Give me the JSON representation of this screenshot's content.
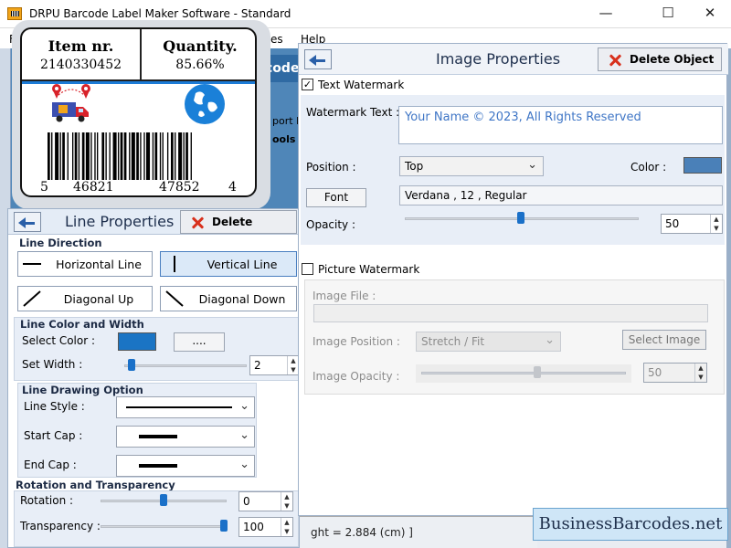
{
  "window": {
    "title": "DRPU Barcode Label Maker Software - Standard",
    "minimize_glyph": "—",
    "maximize_glyph": "☐",
    "close_glyph": "✕"
  },
  "background": {
    "menu_fragments": [
      "F",
      "es",
      "Help"
    ],
    "toolbar_fragment": "code",
    "export_fragment": "port I",
    "tools_fragment": "ools",
    "status_text": "ght = 2.884 (cm) ]"
  },
  "label": {
    "item_key": "Item nr.",
    "item_value": "2140330452",
    "qty_key": "Quantity.",
    "qty_value": "85.66%",
    "barcode_digits": [
      "5",
      "46821",
      "47852",
      "4"
    ]
  },
  "line_properties": {
    "title": "Line Properties",
    "delete_label": "Delete Object",
    "direction": {
      "title": "Line Direction",
      "options": [
        "Horizontal Line",
        "Vertical Line",
        "Diagonal Up",
        "Diagonal Down"
      ],
      "selected": "Vertical Line"
    },
    "color_width": {
      "title": "Line Color and Width",
      "select_color_label": "Select Color :",
      "color": "#1a74c4",
      "more_button": "....",
      "set_width_label": "Set Width :",
      "width_value": "2"
    },
    "drawing": {
      "title": "Line Drawing Option",
      "line_style_label": "Line Style :",
      "start_cap_label": "Start Cap :",
      "end_cap_label": "End Cap :"
    },
    "rotation": {
      "title": "Rotation and Transparency",
      "rotation_label": "Rotation :",
      "rotation_value": "0",
      "transparency_label": "Transparency :",
      "transparency_value": "100"
    }
  },
  "image_properties": {
    "title": "Image Properties",
    "delete_label": "Delete Object",
    "text_watermark": {
      "checkbox_label": "Text Watermark",
      "checked": true,
      "text_label": "Watermark Text :",
      "text_value": "Your Name © 2023, All Rights Reserved",
      "position_label": "Position :",
      "position_value": "Top",
      "color_label": "Color :",
      "color": "#4a80b8",
      "font_button": "Font",
      "font_value": "Verdana , 12 , Regular",
      "opacity_label": "Opacity :",
      "opacity_value": "50"
    },
    "picture_watermark": {
      "checkbox_label": "Picture Watermark",
      "checked": false,
      "image_file_label": "Image File :",
      "image_position_label": "Image Position :",
      "image_position_value": "Stretch / Fit",
      "select_image_button": "Select Image",
      "image_opacity_label": "Image Opacity :",
      "image_opacity_value": "50"
    }
  },
  "brand": "BusinessBarcodes.net"
}
